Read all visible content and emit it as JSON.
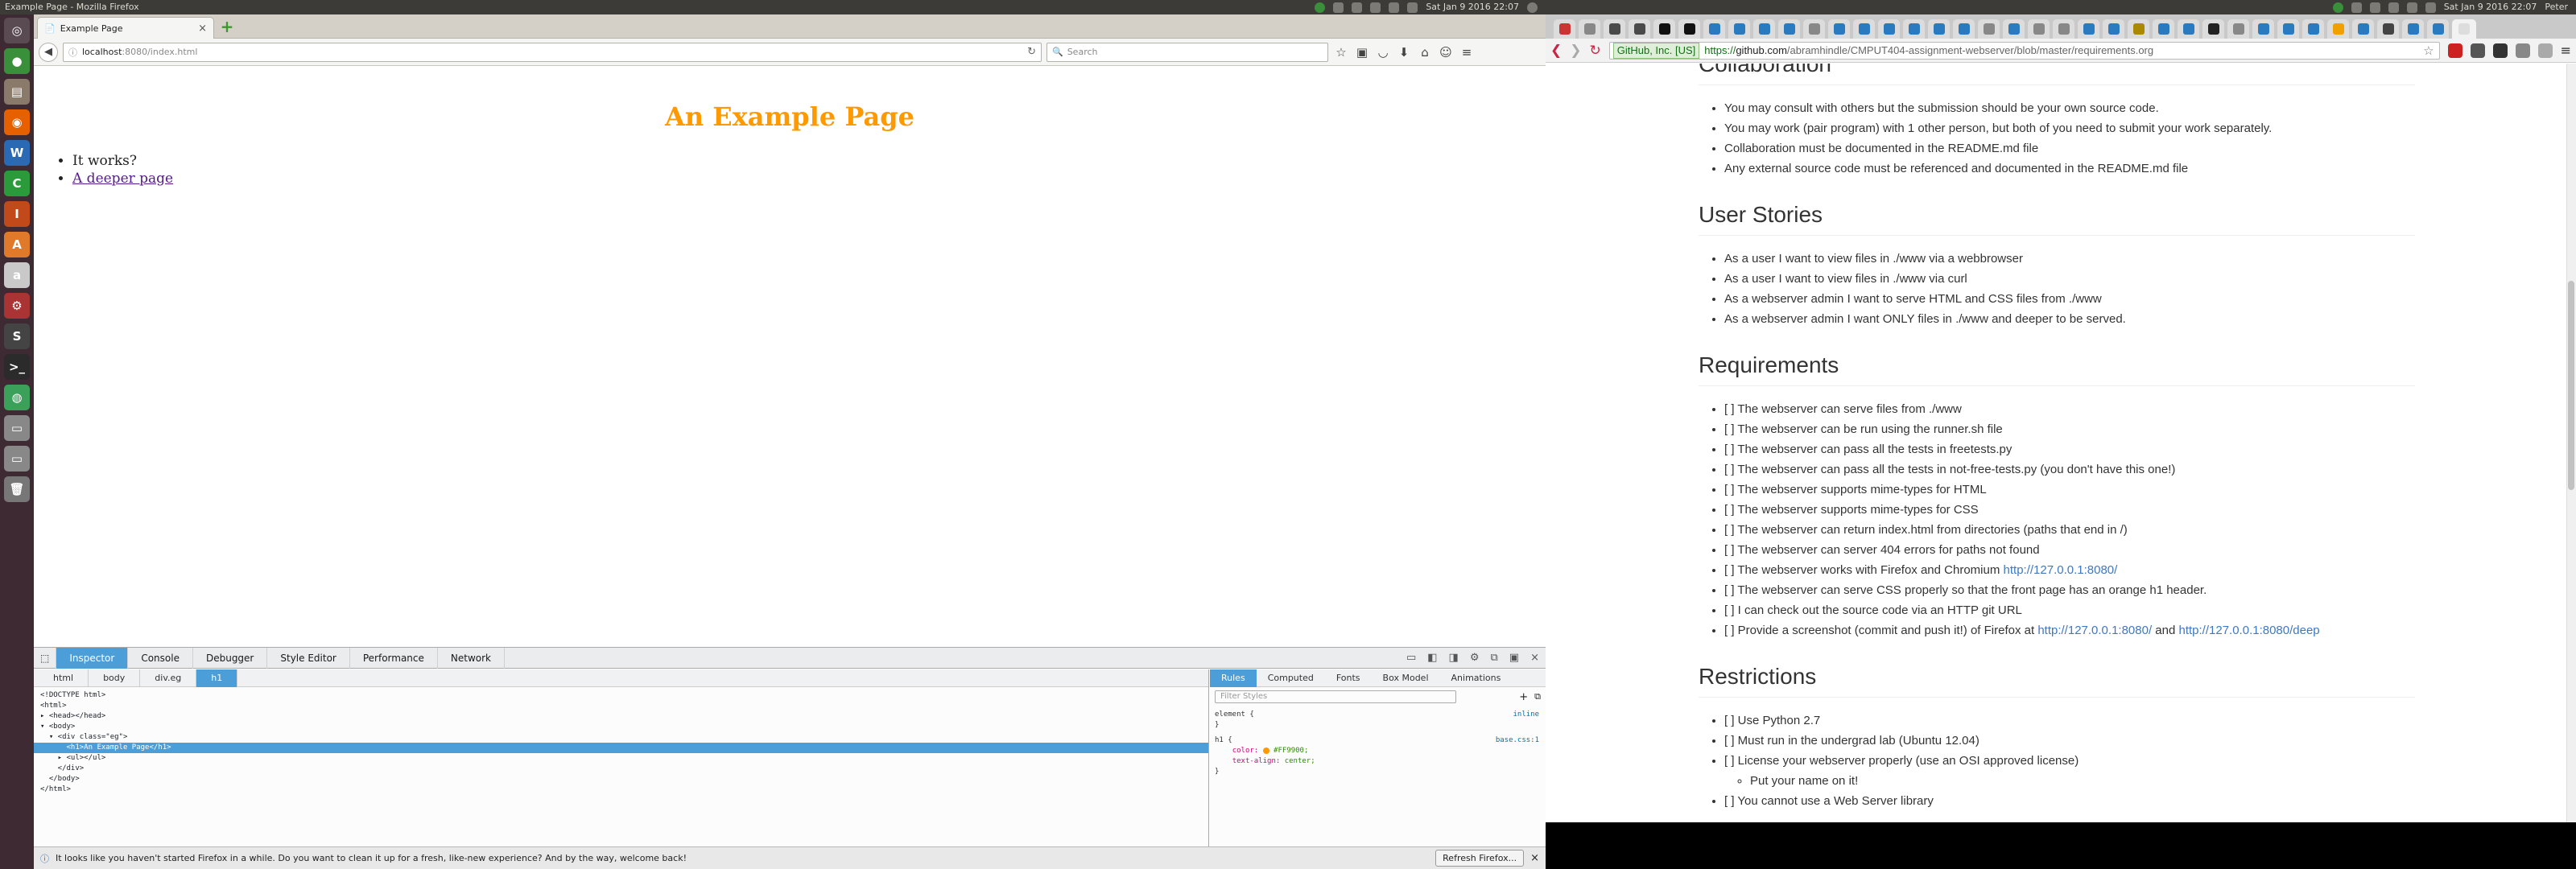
{
  "left_panel": {
    "window_title": "Example Page - Mozilla Firefox",
    "clock": "Sat Jan 9 2016 22:07"
  },
  "right_panel": {
    "clock": "Sat Jan 9 2016 22:07",
    "user": "Peter"
  },
  "launcher": {
    "items": [
      {
        "name": "dash",
        "glyph": "◎",
        "color": "#5a4a52"
      },
      {
        "name": "chrome",
        "glyph": "●",
        "color": "#3a8f3a"
      },
      {
        "name": "files",
        "glyph": "▤",
        "color": "#8a7a6a"
      },
      {
        "name": "firefox",
        "glyph": "◉",
        "color": "#e66000"
      },
      {
        "name": "writer",
        "glyph": "W",
        "color": "#2a6ab5"
      },
      {
        "name": "calc",
        "glyph": "C",
        "color": "#2a9a3a"
      },
      {
        "name": "impress",
        "glyph": "I",
        "color": "#c24a1a"
      },
      {
        "name": "software",
        "glyph": "A",
        "color": "#e07a2a"
      },
      {
        "name": "amazon",
        "glyph": "a",
        "color": "#c9c9c9"
      },
      {
        "name": "settings",
        "glyph": "⚙",
        "color": "#a33"
      },
      {
        "name": "sublime",
        "glyph": "S",
        "color": "#444"
      },
      {
        "name": "terminal",
        "glyph": ">_",
        "color": "#2b2b2b"
      },
      {
        "name": "network",
        "glyph": "◍",
        "color": "#3aa05a"
      },
      {
        "name": "drive1",
        "glyph": "▭",
        "color": "#888"
      },
      {
        "name": "drive2",
        "glyph": "▭",
        "color": "#888"
      },
      {
        "name": "trash",
        "glyph": "🗑",
        "color": "#777"
      }
    ]
  },
  "firefox": {
    "tab_title": "Example Page",
    "url_host": "localhost",
    "url_path": ":8080/index.html",
    "search_placeholder": "Search",
    "page": {
      "heading": "An Example Page",
      "items": [
        "It works?"
      ],
      "link": "A deeper page"
    },
    "devtools": {
      "tabs": [
        "Inspector",
        "Console",
        "Debugger",
        "Style Editor",
        "Performance",
        "Network"
      ],
      "crumbs": [
        "html",
        "body",
        "div.eg",
        "h1"
      ],
      "side_tabs": [
        "Rules",
        "Computed",
        "Fonts",
        "Box Model",
        "Animations"
      ],
      "filter_placeholder": "Filter Styles",
      "rules": {
        "element_selector": "element {",
        "element_source": "inline",
        "close": "}",
        "h1_selector": "h1 {",
        "h1_source": "base.css:1",
        "color_prop": "color:",
        "color_val": "#FF9900;",
        "align_prop": "text-align:",
        "align_val": "center;"
      },
      "markup": [
        "<!DOCTYPE html>",
        "<html>",
        "▸ <head></head>",
        "▾ <body>",
        "  ▾ <div class=\"eg\">",
        "      <h1>An Example Page</h1>",
        "    ▸ <ul></ul>",
        "    </div>",
        "  </body>",
        "</html>"
      ]
    },
    "notification": {
      "text": "It looks like you haven't started Firefox in a while. Do you want to clean it up for a fresh, like-new experience? And by the way, welcome back!",
      "button": "Refresh Firefox..."
    }
  },
  "chrome": {
    "ev_label": "GitHub, Inc. [US]",
    "url_scheme": "https://",
    "url_domain": "github.com",
    "url_rest": "/abramhindle/CMPUT404-assignment-webserver/blob/master/requirements.org",
    "tab_colors": [
      "#c33",
      "#888",
      "#4a4a4a",
      "#4a4a4a",
      "#111",
      "#111",
      "#2a7ac0",
      "#2a7ac0",
      "#2a7ac0",
      "#2a7ac0",
      "#888",
      "#2a7ac0",
      "#2a7ac0",
      "#2a7ac0",
      "#2a7ac0",
      "#2a7ac0",
      "#2a7ac0",
      "#888",
      "#2a7ac0",
      "#888",
      "#888",
      "#2a7ac0",
      "#2a7ac0",
      "#aa8800",
      "#2a7ac0",
      "#2a7ac0",
      "#222",
      "#888",
      "#2a7ac0",
      "#2a7ac0",
      "#2a7ac0",
      "#f0a000",
      "#2a7ac0",
      "#444",
      "#2a7ac0",
      "#2a7ac0",
      "#ddd"
    ],
    "doc": {
      "partial_heading": "Collaboration",
      "collab": [
        "You may consult with others but the submission should be your own source code.",
        "You may work (pair program) with 1 other person, but both of you need to submit your work separately.",
        "Collaboration must be documented in the README.md file",
        "Any external source code must be referenced and documented in the README.md file"
      ],
      "stories_heading": "User Stories",
      "stories": [
        "As a user I want to view files in ./www via a webbrowser",
        "As a user I want to view files in ./www via curl",
        "As a webserver admin I want to serve HTML and CSS files from ./www",
        "As a webserver admin I want ONLY files in ./www and deeper to be served."
      ],
      "req_heading": "Requirements",
      "reqs": [
        "[ ] The webserver can serve files from ./www",
        "[ ] The webserver can be run using the runner.sh file",
        "[ ] The webserver can pass all the tests in freetests.py",
        "[ ] The webserver can pass all the tests in not-free-tests.py (you don't have this one!)",
        "[ ] The webserver supports mime-types for HTML",
        "[ ] The webserver supports mime-types for CSS",
        "[ ] The webserver can return index.html from directories (paths that end in /)",
        "[ ] The webserver can server 404 errors for paths not found"
      ],
      "req_firefox_text": "[ ] The webserver works with Firefox and Chromium ",
      "req_firefox_link": "http://127.0.0.1:8080/",
      "req_css": "[ ] The webserver can serve CSS properly so that the front page has an orange h1 header.",
      "req_git": "[ ] I can check out the source code via an HTTP git URL",
      "req_shot_text": "[ ] Provide a screenshot (commit and push it!) of Firefox at ",
      "req_shot_link1": "http://127.0.0.1:8080/",
      "req_shot_and": " and ",
      "req_shot_link2": "http://127.0.0.1:8080/deep",
      "restr_heading": "Restrictions",
      "restr1": "[ ] Use Python 2.7",
      "restr2": "[ ] Must run in the undergrad lab (Ubuntu 12.04)",
      "restr3": "[ ] License your webserver properly (use an OSI approved license)",
      "restr3_sub": "Put your name on it!",
      "restr4": "[ ] You cannot use a Web Server library"
    }
  }
}
